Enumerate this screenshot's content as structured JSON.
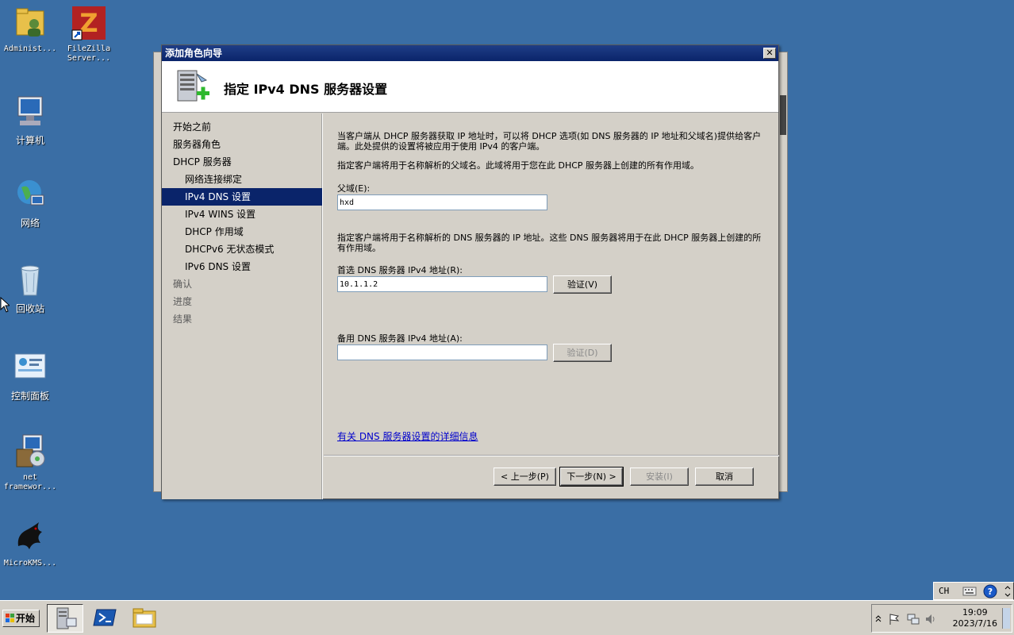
{
  "desktop": {
    "icons": [
      {
        "label": "Administ..."
      },
      {
        "label": "FileZilla Server..."
      },
      {
        "label": "计算机"
      },
      {
        "label": "网络"
      },
      {
        "label": "回收站"
      },
      {
        "label": "控制面板"
      },
      {
        "label": "net framewor..."
      },
      {
        "label": "MicroKMS..."
      }
    ]
  },
  "dialog": {
    "title": "添加角色向导",
    "close_label": "✕",
    "heading": "指定 IPv4 DNS 服务器设置",
    "nav": [
      {
        "label": "开始之前"
      },
      {
        "label": "服务器角色"
      },
      {
        "label": "DHCP 服务器"
      },
      {
        "label": "网络连接绑定"
      },
      {
        "label": "IPv4 DNS 设置"
      },
      {
        "label": "IPv4 WINS 设置"
      },
      {
        "label": "DHCP 作用域"
      },
      {
        "label": "DHCPv6 无状态模式"
      },
      {
        "label": "IPv6 DNS 设置"
      },
      {
        "label": "确认"
      },
      {
        "label": "进度"
      },
      {
        "label": "结果"
      }
    ],
    "intro": "当客户端从 DHCP 服务器获取 IP 地址时，可以将 DHCP 选项(如 DNS 服务器的 IP 地址和父域名)提供给客户端。此处提供的设置将被应用于使用 IPv4 的客户端。",
    "parent_domain_desc": "指定客户端将用于名称解析的父域名。此域将用于您在此 DHCP 服务器上创建的所有作用域。",
    "parent_domain_label": "父域(E):",
    "parent_domain_value": "hxd",
    "dns_desc": "指定客户端将用于名称解析的 DNS 服务器的 IP 地址。这些 DNS 服务器将用于在此 DHCP 服务器上创建的所有作用域。",
    "preferred_label": "首选 DNS 服务器 IPv4 地址(R):",
    "preferred_value": "10.1.1.2",
    "verify1_label": "验证(V)",
    "alternate_label": "备用 DNS 服务器 IPv4 地址(A):",
    "alternate_value": "",
    "verify2_label": "验证(D)",
    "more_info_link": "有关 DNS 服务器设置的详细信息",
    "buttons": {
      "back": "< 上一步(P)",
      "next": "下一步(N) >",
      "install": "安装(I)",
      "cancel": "取消"
    }
  },
  "taskbar": {
    "start_label": "开始",
    "time": "19:09",
    "date": "2023/7/16",
    "lang": "CH"
  }
}
